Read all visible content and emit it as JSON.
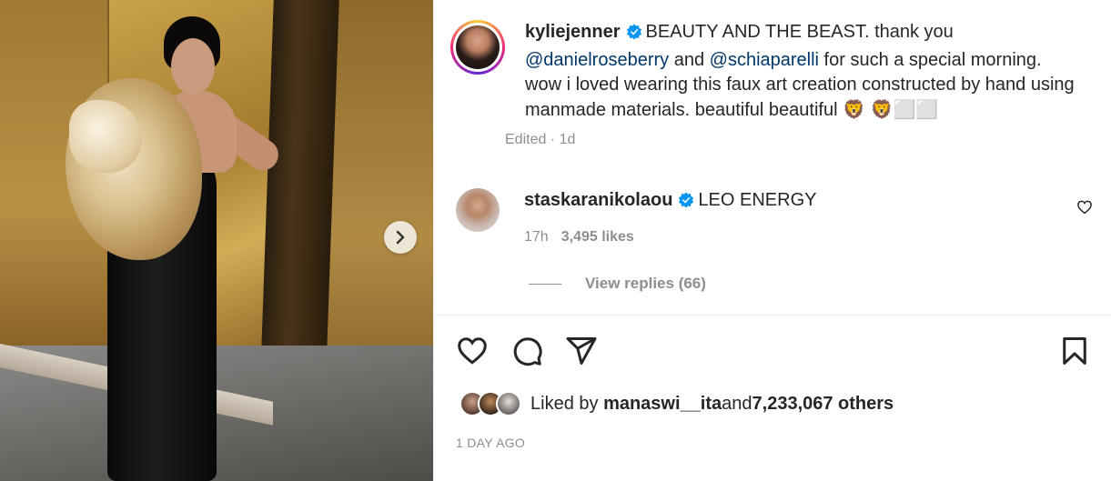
{
  "post": {
    "author": "kyliejenner",
    "caption_parts": [
      "BEAUTY AND THE BEAST. thank you ",
      " and ",
      " for such a special morning. wow i loved wearing this faux art creation constructed by hand using manmade materials. beautiful beautiful "
    ],
    "mentions": [
      "@danielroseberry",
      "@schiaparelli"
    ],
    "caption_emoji": "🦁 🦁",
    "caption_tail": "⬜⬜",
    "edited_label": "Edited · 1d"
  },
  "comment": {
    "username": "staskaranikolaou",
    "text": "LEO ENERGY",
    "age": "17h",
    "likes": "3,495 likes",
    "view_replies": "View replies (66)"
  },
  "likes": {
    "prefix": "Liked by ",
    "first_user": "manaswi__ita",
    "middle": " and ",
    "others": "7,233,067 others"
  },
  "timestamp": "1 DAY AGO",
  "colors": {
    "verified_blue": "#0095f6",
    "mention_blue": "#00376b",
    "muted_gray": "#8e8e8e",
    "text": "#262626"
  }
}
